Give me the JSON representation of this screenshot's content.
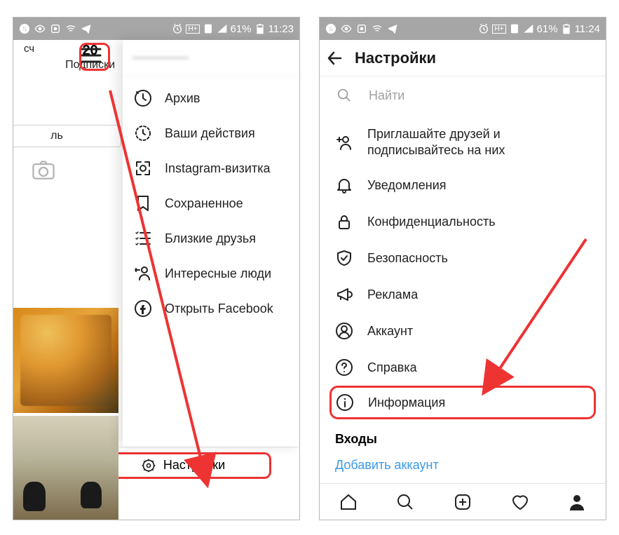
{
  "status": {
    "battery": "61%",
    "time_left": "11:23",
    "time_right": "11:24"
  },
  "left_screen": {
    "username_blur": "————",
    "posts_count": "20",
    "posts_label": "Подписки",
    "partial_label_left": "сч",
    "edit_button": "ль",
    "menu": {
      "archive": "Архив",
      "activity": "Ваши действия",
      "nametag": "Instagram-визитка",
      "saved": "Сохраненное",
      "close_friends": "Близкие друзья",
      "discover": "Интересные люди",
      "facebook": "Открыть Facebook"
    },
    "footer_settings": "Настройки"
  },
  "right_screen": {
    "title": "Настройки",
    "search_placeholder": "Найти",
    "items": {
      "invite": "Приглашайте друзей и подписывайтесь на них",
      "notifications": "Уведомления",
      "privacy": "Конфиденциальность",
      "security": "Безопасность",
      "ads": "Реклама",
      "account": "Аккаунт",
      "help": "Справка",
      "info": "Информация"
    },
    "logins_head": "Входы",
    "add_account": "Добавить аккаунт"
  }
}
